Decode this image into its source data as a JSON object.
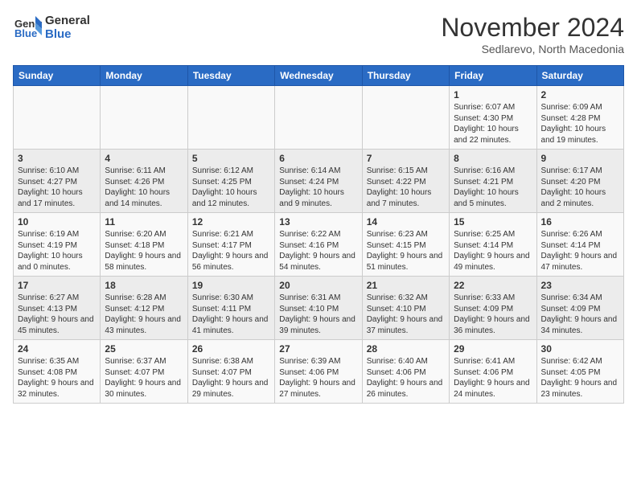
{
  "header": {
    "logo_line1": "General",
    "logo_line2": "Blue",
    "month": "November 2024",
    "location": "Sedlarevo, North Macedonia"
  },
  "weekdays": [
    "Sunday",
    "Monday",
    "Tuesday",
    "Wednesday",
    "Thursday",
    "Friday",
    "Saturday"
  ],
  "rows": [
    [
      {
        "day": "",
        "text": ""
      },
      {
        "day": "",
        "text": ""
      },
      {
        "day": "",
        "text": ""
      },
      {
        "day": "",
        "text": ""
      },
      {
        "day": "",
        "text": ""
      },
      {
        "day": "1",
        "text": "Sunrise: 6:07 AM\nSunset: 4:30 PM\nDaylight: 10 hours and 22 minutes."
      },
      {
        "day": "2",
        "text": "Sunrise: 6:09 AM\nSunset: 4:28 PM\nDaylight: 10 hours and 19 minutes."
      }
    ],
    [
      {
        "day": "3",
        "text": "Sunrise: 6:10 AM\nSunset: 4:27 PM\nDaylight: 10 hours and 17 minutes."
      },
      {
        "day": "4",
        "text": "Sunrise: 6:11 AM\nSunset: 4:26 PM\nDaylight: 10 hours and 14 minutes."
      },
      {
        "day": "5",
        "text": "Sunrise: 6:12 AM\nSunset: 4:25 PM\nDaylight: 10 hours and 12 minutes."
      },
      {
        "day": "6",
        "text": "Sunrise: 6:14 AM\nSunset: 4:24 PM\nDaylight: 10 hours and 9 minutes."
      },
      {
        "day": "7",
        "text": "Sunrise: 6:15 AM\nSunset: 4:22 PM\nDaylight: 10 hours and 7 minutes."
      },
      {
        "day": "8",
        "text": "Sunrise: 6:16 AM\nSunset: 4:21 PM\nDaylight: 10 hours and 5 minutes."
      },
      {
        "day": "9",
        "text": "Sunrise: 6:17 AM\nSunset: 4:20 PM\nDaylight: 10 hours and 2 minutes."
      }
    ],
    [
      {
        "day": "10",
        "text": "Sunrise: 6:19 AM\nSunset: 4:19 PM\nDaylight: 10 hours and 0 minutes."
      },
      {
        "day": "11",
        "text": "Sunrise: 6:20 AM\nSunset: 4:18 PM\nDaylight: 9 hours and 58 minutes."
      },
      {
        "day": "12",
        "text": "Sunrise: 6:21 AM\nSunset: 4:17 PM\nDaylight: 9 hours and 56 minutes."
      },
      {
        "day": "13",
        "text": "Sunrise: 6:22 AM\nSunset: 4:16 PM\nDaylight: 9 hours and 54 minutes."
      },
      {
        "day": "14",
        "text": "Sunrise: 6:23 AM\nSunset: 4:15 PM\nDaylight: 9 hours and 51 minutes."
      },
      {
        "day": "15",
        "text": "Sunrise: 6:25 AM\nSunset: 4:14 PM\nDaylight: 9 hours and 49 minutes."
      },
      {
        "day": "16",
        "text": "Sunrise: 6:26 AM\nSunset: 4:14 PM\nDaylight: 9 hours and 47 minutes."
      }
    ],
    [
      {
        "day": "17",
        "text": "Sunrise: 6:27 AM\nSunset: 4:13 PM\nDaylight: 9 hours and 45 minutes."
      },
      {
        "day": "18",
        "text": "Sunrise: 6:28 AM\nSunset: 4:12 PM\nDaylight: 9 hours and 43 minutes."
      },
      {
        "day": "19",
        "text": "Sunrise: 6:30 AM\nSunset: 4:11 PM\nDaylight: 9 hours and 41 minutes."
      },
      {
        "day": "20",
        "text": "Sunrise: 6:31 AM\nSunset: 4:10 PM\nDaylight: 9 hours and 39 minutes."
      },
      {
        "day": "21",
        "text": "Sunrise: 6:32 AM\nSunset: 4:10 PM\nDaylight: 9 hours and 37 minutes."
      },
      {
        "day": "22",
        "text": "Sunrise: 6:33 AM\nSunset: 4:09 PM\nDaylight: 9 hours and 36 minutes."
      },
      {
        "day": "23",
        "text": "Sunrise: 6:34 AM\nSunset: 4:09 PM\nDaylight: 9 hours and 34 minutes."
      }
    ],
    [
      {
        "day": "24",
        "text": "Sunrise: 6:35 AM\nSunset: 4:08 PM\nDaylight: 9 hours and 32 minutes."
      },
      {
        "day": "25",
        "text": "Sunrise: 6:37 AM\nSunset: 4:07 PM\nDaylight: 9 hours and 30 minutes."
      },
      {
        "day": "26",
        "text": "Sunrise: 6:38 AM\nSunset: 4:07 PM\nDaylight: 9 hours and 29 minutes."
      },
      {
        "day": "27",
        "text": "Sunrise: 6:39 AM\nSunset: 4:06 PM\nDaylight: 9 hours and 27 minutes."
      },
      {
        "day": "28",
        "text": "Sunrise: 6:40 AM\nSunset: 4:06 PM\nDaylight: 9 hours and 26 minutes."
      },
      {
        "day": "29",
        "text": "Sunrise: 6:41 AM\nSunset: 4:06 PM\nDaylight: 9 hours and 24 minutes."
      },
      {
        "day": "30",
        "text": "Sunrise: 6:42 AM\nSunset: 4:05 PM\nDaylight: 9 hours and 23 minutes."
      }
    ]
  ]
}
